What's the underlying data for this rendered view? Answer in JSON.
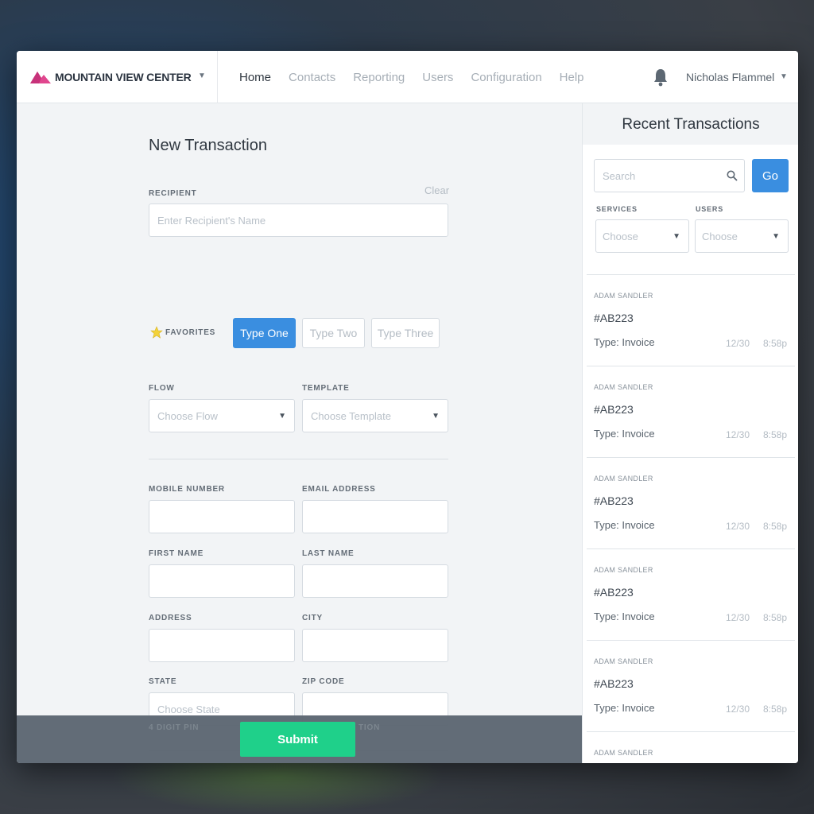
{
  "header": {
    "brand": "MOUNTAIN VIEW CENTER",
    "nav": [
      "Home",
      "Contacts",
      "Reporting",
      "Users",
      "Configuration",
      "Help"
    ],
    "active_nav": "Home",
    "user_name": "Nicholas Flammel",
    "caret": "▼"
  },
  "form": {
    "title": "New Transaction",
    "recipient_label": "RECIPIENT",
    "clear_label": "Clear",
    "recipient_placeholder": "Enter Recipient's Name",
    "favorites_label": "FAVORITES",
    "types": [
      "Type One",
      "Type Two",
      "Type Three"
    ],
    "active_type": "Type One",
    "flow_label": "FLOW",
    "flow_placeholder": "Choose Flow",
    "template_label": "TEMPLATE",
    "template_placeholder": "Choose Template",
    "mobile_label": "MOBILE NUMBER",
    "email_label": "EMAIL ADDRESS",
    "first_name_label": "FIRST NAME",
    "last_name_label": "LAST NAME",
    "address_label": "ADDRESS",
    "city_label": "CITY",
    "state_label": "STATE",
    "state_placeholder": "Choose State",
    "zip_label": "ZIP CODE",
    "pin_label": "4 DIGIT PIN",
    "hidden_label_tail": "TION",
    "submit_label": "Submit"
  },
  "sidebar": {
    "title": "Recent Transactions",
    "search_placeholder": "Search",
    "go_label": "Go",
    "services_label": "SERVICES",
    "services_value": "Choose",
    "users_label": "USERS",
    "users_value": "Choose",
    "transactions": [
      {
        "name": "ADAM SANDLER",
        "id": "#AB223",
        "type": "Type: Invoice",
        "date": "12/30",
        "time": "8:58p"
      },
      {
        "name": "ADAM SANDLER",
        "id": "#AB223",
        "type": "Type: Invoice",
        "date": "12/30",
        "time": "8:58p"
      },
      {
        "name": "ADAM SANDLER",
        "id": "#AB223",
        "type": "Type: Invoice",
        "date": "12/30",
        "time": "8:58p"
      },
      {
        "name": "ADAM SANDLER",
        "id": "#AB223",
        "type": "Type: Invoice",
        "date": "12/30",
        "time": "8:58p"
      },
      {
        "name": "ADAM SANDLER",
        "id": "#AB223",
        "type": "Type: Invoice",
        "date": "12/30",
        "time": "8:58p"
      },
      {
        "name": "ADAM SANDLER",
        "id": "",
        "type": "",
        "date": "",
        "time": ""
      }
    ]
  },
  "colors": {
    "accent": "#3a8ee0",
    "submit": "#1fd08a",
    "logo": "#e0468e"
  }
}
